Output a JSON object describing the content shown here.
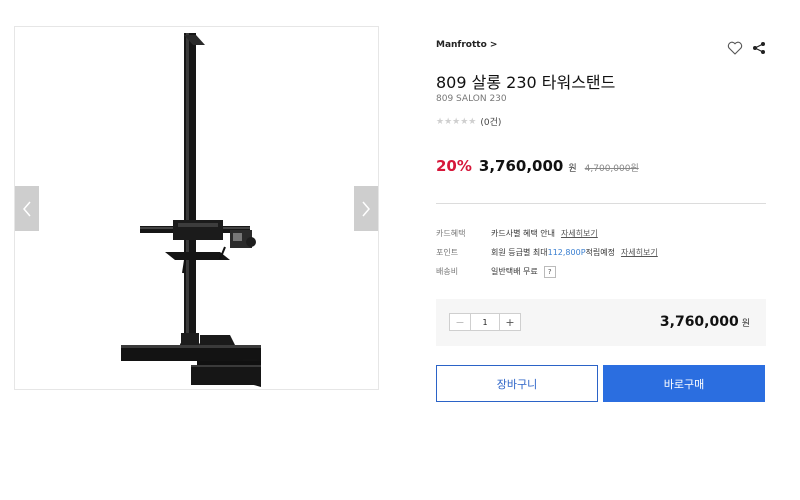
{
  "breadcrumb": [
    "",
    "",
    ""
  ],
  "gallery": {
    "prev_icon": "chevron-left-icon",
    "next_icon": "chevron-right-icon"
  },
  "product": {
    "brand": "Manfrotto >",
    "title": "809 살롱 230 타워스탠드",
    "subtitle": "809 SALON 230",
    "stars": "★★★★★",
    "rating": 0,
    "review_count": "(0건)",
    "discount": "20%",
    "price": "3,760,000",
    "price_unit": "원",
    "original_price": "4,700,000원"
  },
  "icons": {
    "wishlist": "heart-outline-icon",
    "share": "share-icon"
  },
  "benefits": {
    "card": {
      "label": "카드혜택",
      "value": "카드사별 혜택 안내",
      "link": "자세히보기"
    },
    "point": {
      "label": "포인트",
      "prefix": "회원 등급별 최대 ",
      "amount": "112,800P",
      "suffix": " 적립예정",
      "link": "자세히보기"
    },
    "shipping": {
      "label": "배송비",
      "value": "일반택배 무료",
      "help": "?"
    }
  },
  "order": {
    "minus": "−",
    "plus": "+",
    "quantity": "1",
    "total": "3,760,000",
    "total_unit": "원"
  },
  "buttons": {
    "cart": "장바구니",
    "buy": "바로구매"
  },
  "colors": {
    "accent": "#2b6ee0",
    "discount": "#d6173a",
    "point": "#3a7fd0"
  }
}
